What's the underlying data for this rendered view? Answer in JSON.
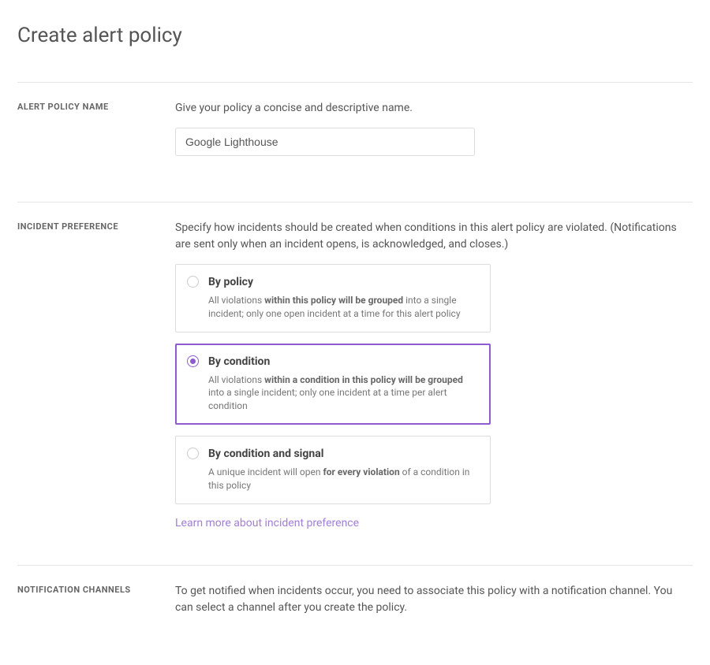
{
  "page": {
    "title": "Create alert policy"
  },
  "sections": {
    "name": {
      "label": "ALERT POLICY NAME",
      "help": "Give your policy a concise and descriptive name.",
      "value": "Google Lighthouse"
    },
    "incident": {
      "label": "INCIDENT PREFERENCE",
      "help": "Specify how incidents should be created when conditions in this alert policy are violated. (Notifications are sent only when an incident opens, is acknowledged, and closes.)",
      "options": {
        "byPolicy": {
          "title": "By policy",
          "desc_pre": "All violations ",
          "desc_bold": "within this policy will be grouped",
          "desc_post": " into a single incident; only one open incident at a time for this alert policy"
        },
        "byCondition": {
          "title": "By condition",
          "desc_pre": "All violations ",
          "desc_bold": "within a condition in this policy will be grouped",
          "desc_post": " into a single incident; only one incident at a time per alert condition"
        },
        "byConditionSignal": {
          "title": "By condition and signal",
          "desc_pre": "A unique incident will open ",
          "desc_bold": "for every violation",
          "desc_post": " of a condition in this policy"
        }
      },
      "learnMore": "Learn more about incident preference"
    },
    "notification": {
      "label": "NOTIFICATION CHANNELS",
      "help": "To get notified when incidents occur, you need to associate this policy with a notification channel. You can select a channel after you create the policy."
    }
  }
}
